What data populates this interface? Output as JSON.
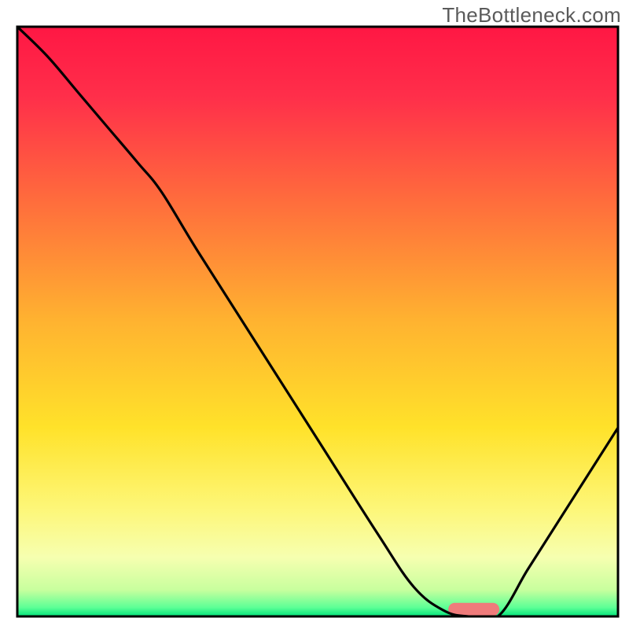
{
  "watermark": "TheBottleneck.com",
  "chart_data": {
    "type": "line",
    "title": "",
    "xlabel": "",
    "ylabel": "",
    "xlim": [
      0,
      100
    ],
    "ylim": [
      0,
      100
    ],
    "grid": false,
    "legend": false,
    "background_gradient_stops": [
      {
        "offset": 0.0,
        "color": "#ff1744"
      },
      {
        "offset": 0.12,
        "color": "#ff2f4a"
      },
      {
        "offset": 0.3,
        "color": "#ff6e3c"
      },
      {
        "offset": 0.5,
        "color": "#ffb330"
      },
      {
        "offset": 0.68,
        "color": "#ffe22a"
      },
      {
        "offset": 0.82,
        "color": "#fdf77a"
      },
      {
        "offset": 0.9,
        "color": "#f6ffb0"
      },
      {
        "offset": 0.955,
        "color": "#c8ff9e"
      },
      {
        "offset": 0.985,
        "color": "#5cff96"
      },
      {
        "offset": 1.0,
        "color": "#00e37a"
      }
    ],
    "series": [
      {
        "name": "bottleneck-curve",
        "color": "#000000",
        "stroke_width": 3.2,
        "x": [
          0,
          5,
          10,
          15,
          20,
          24,
          30,
          40,
          50,
          60,
          66,
          71,
          75,
          80,
          85,
          90,
          95,
          100
        ],
        "y": [
          100,
          95,
          89,
          83,
          77,
          72,
          62,
          46,
          30,
          14,
          5,
          1,
          0,
          0,
          8,
          16,
          24,
          32
        ]
      }
    ],
    "marker": {
      "name": "optimal-band",
      "shape": "rounded-rect",
      "x_center": 76,
      "y_center": 1.2,
      "width": 8.5,
      "height": 2.2,
      "fill": "#ef7b7b",
      "rx": 1.1
    },
    "frame": {
      "stroke": "#000000",
      "stroke_width": 3
    }
  }
}
